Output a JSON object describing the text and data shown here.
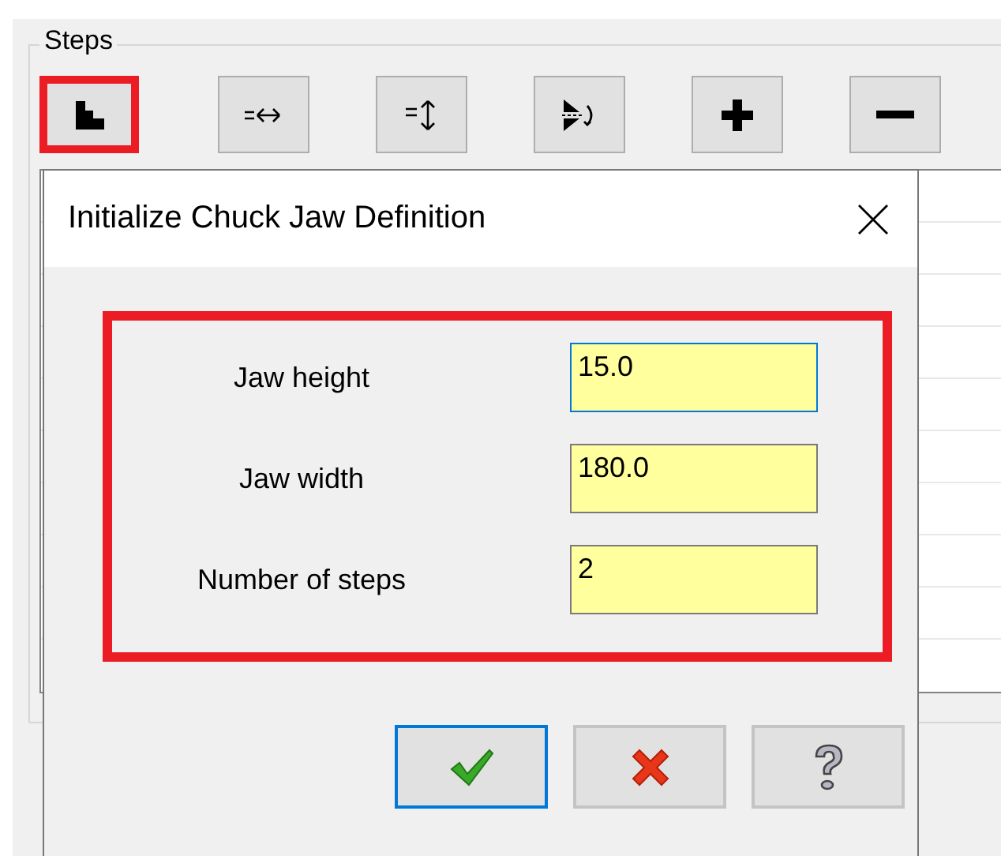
{
  "group": {
    "title": "Steps"
  },
  "toolbar": [
    {
      "kind": "init",
      "highlighted": true
    },
    {
      "kind": "width",
      "highlighted": false
    },
    {
      "kind": "height",
      "highlighted": false
    },
    {
      "kind": "mirror",
      "highlighted": false
    },
    {
      "kind": "add",
      "highlighted": false
    },
    {
      "kind": "remove",
      "highlighted": false
    }
  ],
  "dialog": {
    "title": "Initialize Chuck Jaw Definition",
    "form_highlighted": true,
    "fields": [
      {
        "label": "Jaw height",
        "value": "15.0",
        "focused": true
      },
      {
        "label": "Jaw width",
        "value": "180.0",
        "focused": false
      },
      {
        "label": "Number of steps",
        "value": "2",
        "focused": false
      }
    ],
    "buttons": [
      {
        "kind": "ok",
        "focused": true
      },
      {
        "kind": "cancel",
        "focused": false
      },
      {
        "kind": "help",
        "focused": false
      }
    ]
  }
}
